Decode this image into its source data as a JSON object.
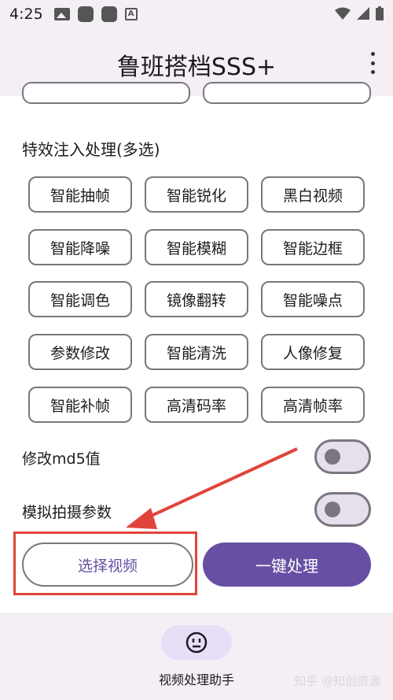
{
  "status_bar": {
    "time": "4:25",
    "left_icons": [
      "image-icon",
      "app-square-icon",
      "app-square-icon",
      "font-a-icon"
    ],
    "right_icons": [
      "wifi-icon",
      "signal-icon",
      "battery-icon"
    ]
  },
  "app_bar": {
    "title": "鲁班搭档SSS+",
    "menu_icon": "more-vert-icon"
  },
  "effects": {
    "title": "特效注入处理(多选)",
    "chips": [
      "智能抽帧",
      "智能锐化",
      "黑白视频",
      "智能降噪",
      "智能模糊",
      "智能边框",
      "智能调色",
      "镜像翻转",
      "智能噪点",
      "参数修改",
      "智能清洗",
      "人像修复",
      "智能补帧",
      "高清码率",
      "高清帧率"
    ]
  },
  "switches": [
    {
      "label": "修改md5值",
      "on": false
    },
    {
      "label": "模拟拍摄参数",
      "on": false
    }
  ],
  "actions": {
    "select_video": "选择视频",
    "one_click_process": "一键处理"
  },
  "bottom_nav": {
    "label": "视频处理助手",
    "icon": "face-icon"
  },
  "watermark": "知乎 @知创资源",
  "colors": {
    "primary": "#6750a4",
    "surface_tint": "#f4eff5",
    "outline": "#7b757f",
    "annotation_red": "#e0453b"
  }
}
